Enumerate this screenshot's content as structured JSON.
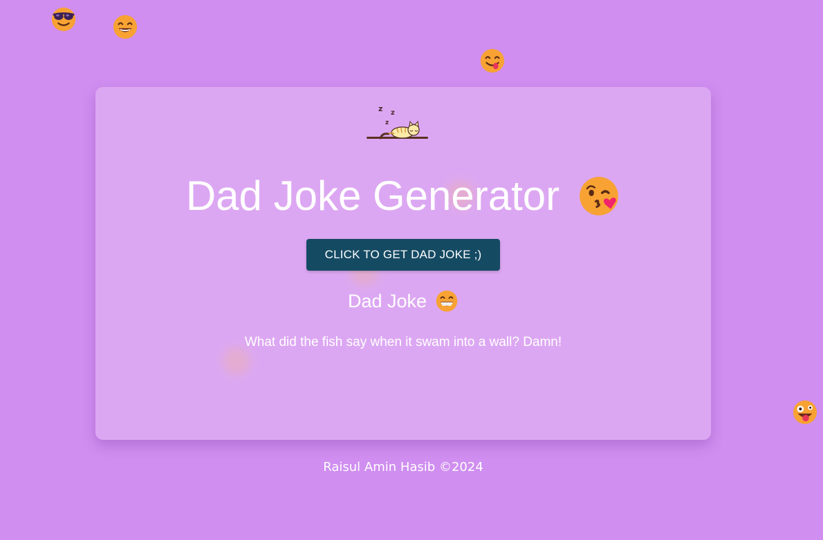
{
  "header": {
    "title": "Dad Joke Generator",
    "title_emoji": "kissing-face-with-heart"
  },
  "button": {
    "label": "CLICK TO GET DAD JOKE ;)"
  },
  "joke": {
    "heading": "Dad Joke",
    "heading_emoji": "grinning-face-with-teeth",
    "text": "What did the fish say when it swam into a wall? Damn!"
  },
  "footer": {
    "text": "Raisul Amin Hasib ©2024"
  },
  "logo": {
    "icon": "sleeping-cat-icon",
    "zzz": [
      "z",
      "z",
      "z"
    ]
  },
  "floating_emojis": [
    "sunglasses-face",
    "smiling-face",
    "yummy-face",
    "zany-face"
  ],
  "colors": {
    "background": "#cf8ef0",
    "card": "#e0b2f3",
    "button": "#154a63",
    "text": "#ffffff"
  }
}
